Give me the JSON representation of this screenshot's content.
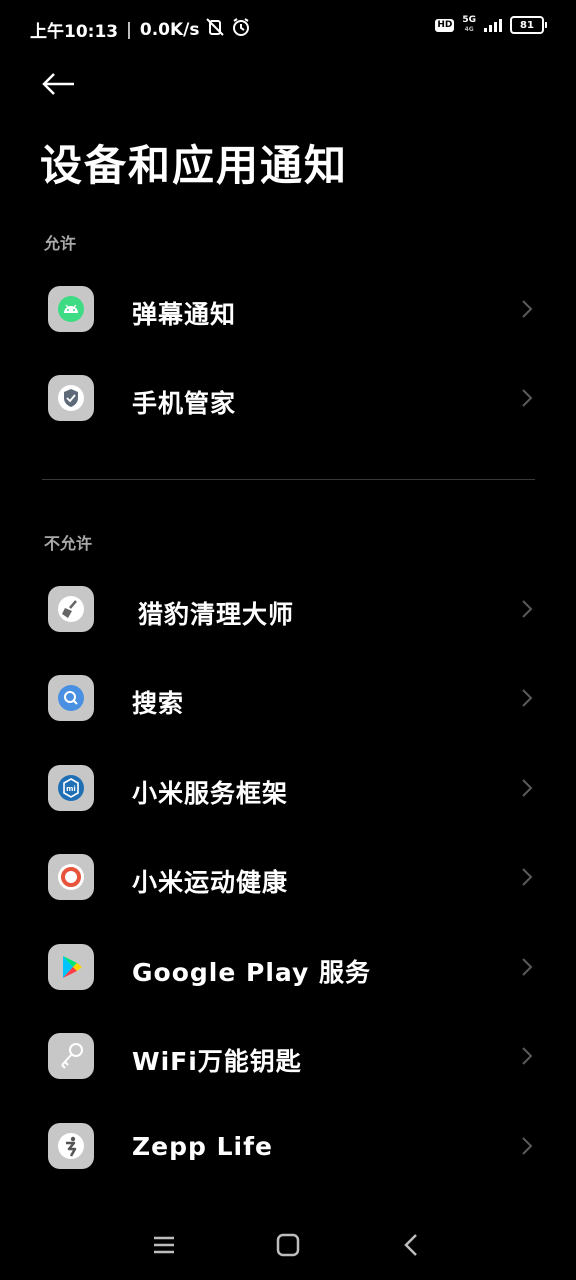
{
  "status_bar": {
    "time": "上午10:13",
    "separator": "|",
    "net_speed": "0.0K/s",
    "hd": "HD",
    "network": "5G",
    "network_sub": "4G",
    "battery": "81"
  },
  "header": {
    "title": "设备和应用通知"
  },
  "sections": {
    "allowed": {
      "label": "允许",
      "items": [
        {
          "label": "弹幕通知",
          "icon": "android-icon"
        },
        {
          "label": "手机管家",
          "icon": "shield-icon"
        }
      ]
    },
    "not_allowed": {
      "label": "不允许",
      "items": [
        {
          "label": "猎豹清理大师",
          "icon": "broom-icon"
        },
        {
          "label": "搜索",
          "icon": "search-icon"
        },
        {
          "label": "小米服务框架",
          "icon": "mi-icon"
        },
        {
          "label": "小米运动健康",
          "icon": "ring-icon"
        },
        {
          "label": "Google Play 服务",
          "icon": "play-icon"
        },
        {
          "label": "WiFi万能钥匙",
          "icon": "key-icon"
        },
        {
          "label": "Zepp Life",
          "icon": "zepp-icon"
        }
      ]
    }
  },
  "colors": {
    "background": "#000000",
    "text": "#ffffff",
    "section_header": "#a9a9a9",
    "icon_bg": "#c7c7c7",
    "chevron": "#5a5a5a"
  }
}
